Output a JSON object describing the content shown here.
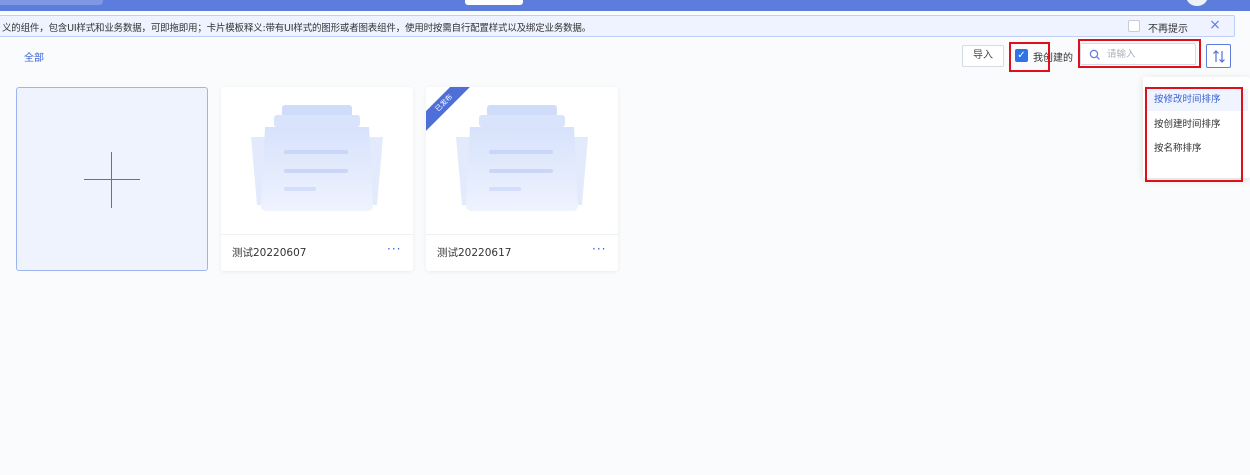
{
  "notice": {
    "text": "义的组件，包含UI样式和业务数据，可即拖即用；卡片模板释义:带有UI样式的图形或者图表组件，使用时按需自行配置样式以及绑定业务数据。",
    "checkbox_label": "不再提示",
    "close_icon": "×"
  },
  "filters": {
    "all_label": "全部"
  },
  "toolbar": {
    "import_label": "导入",
    "mine_label": "我创建的",
    "mine_checked": true,
    "search_placeholder": "请输入"
  },
  "sort_menu": {
    "items": [
      {
        "label": "按修改时间排序",
        "active": true
      },
      {
        "label": "按创建时间排序",
        "active": false
      },
      {
        "label": "按名称排序",
        "active": false
      }
    ]
  },
  "cards": [
    {
      "name": "测试20220607",
      "published": false,
      "more": "···"
    },
    {
      "name": "测试20220617",
      "published": true,
      "ribbon": "已发布",
      "more": "···"
    }
  ],
  "colors": {
    "accent": "#5c7ddc",
    "highlight": "#e0101b"
  }
}
